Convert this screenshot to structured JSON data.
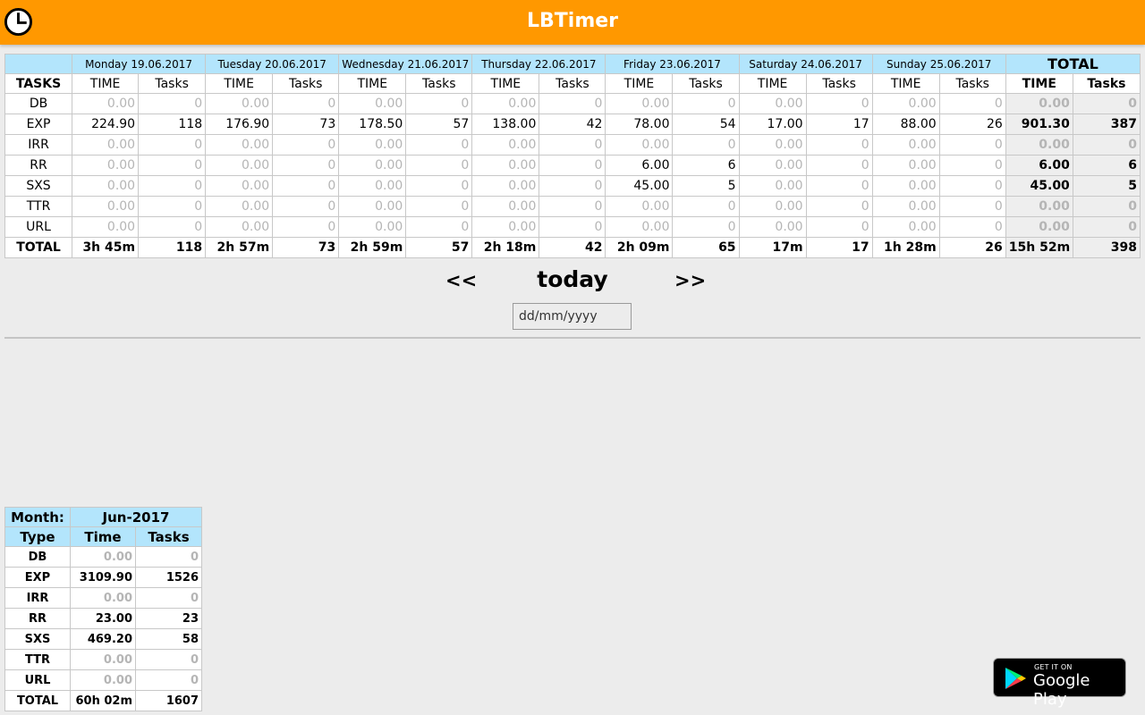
{
  "app": {
    "title": "LBTimer"
  },
  "week": {
    "days": [
      "Monday 19.06.2017",
      "Tuesday 20.06.2017",
      "Wednesday 21.06.2017",
      "Thursday 22.06.2017",
      "Friday 23.06.2017",
      "Saturday 24.06.2017",
      "Sunday 25.06.2017"
    ],
    "total_label": "TOTAL",
    "tasks_header": "TASKS",
    "time_header": "TIME",
    "count_header": "Tasks",
    "rows": [
      {
        "task": "DB",
        "cells": [
          [
            "0.00",
            "0"
          ],
          [
            "0.00",
            "0"
          ],
          [
            "0.00",
            "0"
          ],
          [
            "0.00",
            "0"
          ],
          [
            "0.00",
            "0"
          ],
          [
            "0.00",
            "0"
          ],
          [
            "0.00",
            "0"
          ]
        ],
        "total": [
          "0.00",
          "0"
        ]
      },
      {
        "task": "EXP",
        "cells": [
          [
            "224.90",
            "118"
          ],
          [
            "176.90",
            "73"
          ],
          [
            "178.50",
            "57"
          ],
          [
            "138.00",
            "42"
          ],
          [
            "78.00",
            "54"
          ],
          [
            "17.00",
            "17"
          ],
          [
            "88.00",
            "26"
          ]
        ],
        "total": [
          "901.30",
          "387"
        ]
      },
      {
        "task": "IRR",
        "cells": [
          [
            "0.00",
            "0"
          ],
          [
            "0.00",
            "0"
          ],
          [
            "0.00",
            "0"
          ],
          [
            "0.00",
            "0"
          ],
          [
            "0.00",
            "0"
          ],
          [
            "0.00",
            "0"
          ],
          [
            "0.00",
            "0"
          ]
        ],
        "total": [
          "0.00",
          "0"
        ]
      },
      {
        "task": "RR",
        "cells": [
          [
            "0.00",
            "0"
          ],
          [
            "0.00",
            "0"
          ],
          [
            "0.00",
            "0"
          ],
          [
            "0.00",
            "0"
          ],
          [
            "6.00",
            "6"
          ],
          [
            "0.00",
            "0"
          ],
          [
            "0.00",
            "0"
          ]
        ],
        "total": [
          "6.00",
          "6"
        ]
      },
      {
        "task": "SXS",
        "cells": [
          [
            "0.00",
            "0"
          ],
          [
            "0.00",
            "0"
          ],
          [
            "0.00",
            "0"
          ],
          [
            "0.00",
            "0"
          ],
          [
            "45.00",
            "5"
          ],
          [
            "0.00",
            "0"
          ],
          [
            "0.00",
            "0"
          ]
        ],
        "total": [
          "45.00",
          "5"
        ]
      },
      {
        "task": "TTR",
        "cells": [
          [
            "0.00",
            "0"
          ],
          [
            "0.00",
            "0"
          ],
          [
            "0.00",
            "0"
          ],
          [
            "0.00",
            "0"
          ],
          [
            "0.00",
            "0"
          ],
          [
            "0.00",
            "0"
          ],
          [
            "0.00",
            "0"
          ]
        ],
        "total": [
          "0.00",
          "0"
        ]
      },
      {
        "task": "URL",
        "cells": [
          [
            "0.00",
            "0"
          ],
          [
            "0.00",
            "0"
          ],
          [
            "0.00",
            "0"
          ],
          [
            "0.00",
            "0"
          ],
          [
            "0.00",
            "0"
          ],
          [
            "0.00",
            "0"
          ],
          [
            "0.00",
            "0"
          ]
        ],
        "total": [
          "0.00",
          "0"
        ]
      }
    ],
    "totals_row": {
      "label": "TOTAL",
      "cells": [
        [
          "3h 45m",
          "118"
        ],
        [
          "2h 57m",
          "73"
        ],
        [
          "2h 59m",
          "57"
        ],
        [
          "2h 18m",
          "42"
        ],
        [
          "2h 09m",
          "65"
        ],
        [
          "17m",
          "17"
        ],
        [
          "1h 28m",
          "26"
        ]
      ],
      "total": [
        "15h 52m",
        "398"
      ]
    }
  },
  "nav": {
    "prev_label": "<<",
    "today_label": "today",
    "next_label": ">>",
    "date_placeholder": "dd/mm/yyyy"
  },
  "month": {
    "month_label": "Month:",
    "month_value": "Jun-2017",
    "type_header": "Type",
    "time_header": "Time",
    "tasks_header": "Tasks",
    "rows": [
      {
        "type": "DB",
        "time": "0.00",
        "tasks": "0"
      },
      {
        "type": "EXP",
        "time": "3109.90",
        "tasks": "1526"
      },
      {
        "type": "IRR",
        "time": "0.00",
        "tasks": "0"
      },
      {
        "type": "RR",
        "time": "23.00",
        "tasks": "23"
      },
      {
        "type": "SXS",
        "time": "469.20",
        "tasks": "58"
      },
      {
        "type": "TTR",
        "time": "0.00",
        "tasks": "0"
      },
      {
        "type": "URL",
        "time": "0.00",
        "tasks": "0"
      }
    ],
    "total": {
      "label": "TOTAL",
      "time": "60h 02m",
      "tasks": "1607"
    }
  },
  "store_badge": {
    "small": "GET IT ON",
    "big": "Google Play"
  },
  "icons": {
    "app_icon": "clock-icon",
    "store_icon": "google-play-icon"
  },
  "colors": {
    "accent": "#ff9800",
    "header_blue": "#b3e5fc",
    "zero_gray": "#b5b5b5"
  }
}
